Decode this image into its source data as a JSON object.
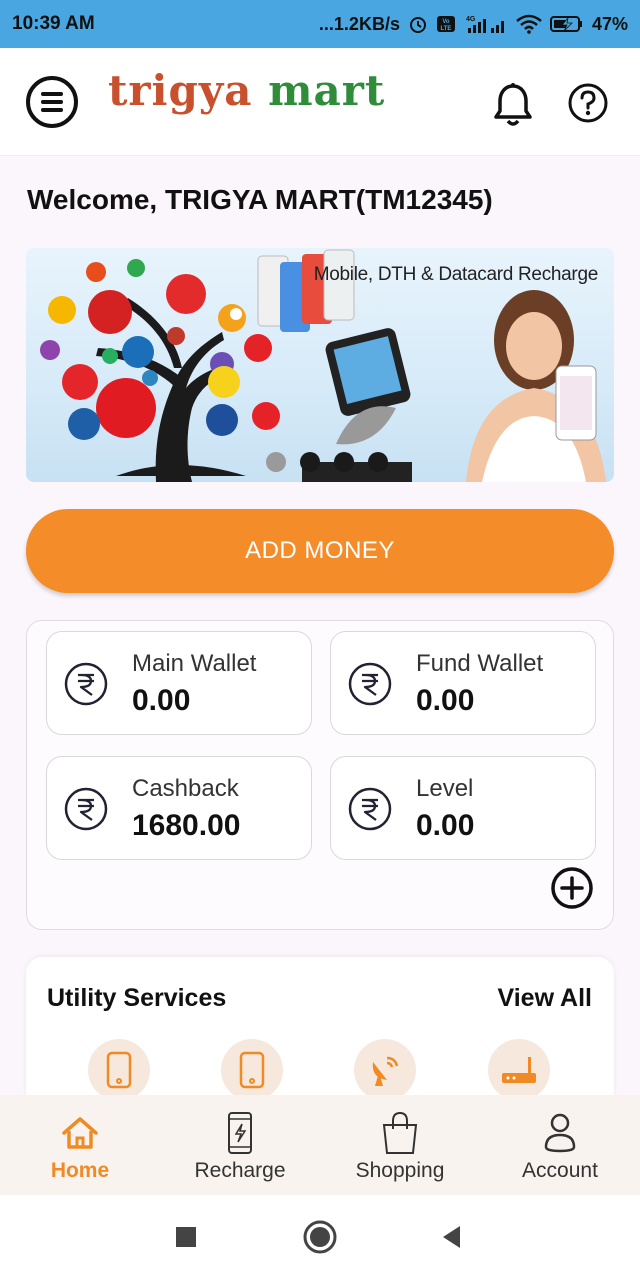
{
  "status_bar": {
    "time": "10:39 AM",
    "net_speed": "...1.2KB/s",
    "network": "4G",
    "battery": "47%"
  },
  "header": {
    "logo_part1": "trigya",
    "logo_part2": "mart"
  },
  "welcome_text": "Welcome, TRIGYA MART(TM12345)",
  "banner": {
    "caption": "Mobile, DTH & Datacard Recharge",
    "slides": 4,
    "active_slide": 1
  },
  "add_money_label": "ADD MONEY",
  "wallets": [
    {
      "label": "Main Wallet",
      "value": "0.00"
    },
    {
      "label": "Fund Wallet",
      "value": "0.00"
    },
    {
      "label": "Cashback",
      "value": "1680.00"
    },
    {
      "label": "Level",
      "value": "0.00"
    }
  ],
  "utility": {
    "title": "Utility Services",
    "view_all": "View All",
    "icons": [
      "mobile-icon",
      "mobile-icon",
      "dth-dish-icon",
      "router-icon"
    ]
  },
  "bottom_nav": [
    {
      "label": "Home",
      "icon": "home-icon",
      "active": true
    },
    {
      "label": "Recharge",
      "icon": "phone-recharge-icon",
      "active": false
    },
    {
      "label": "Shopping",
      "icon": "shopping-bag-icon",
      "active": false
    },
    {
      "label": "Account",
      "icon": "account-icon",
      "active": false
    }
  ],
  "colors": {
    "status_bar": "#4aa6e0",
    "accent": "#f48c2a",
    "active_nav": "#f08a25"
  }
}
